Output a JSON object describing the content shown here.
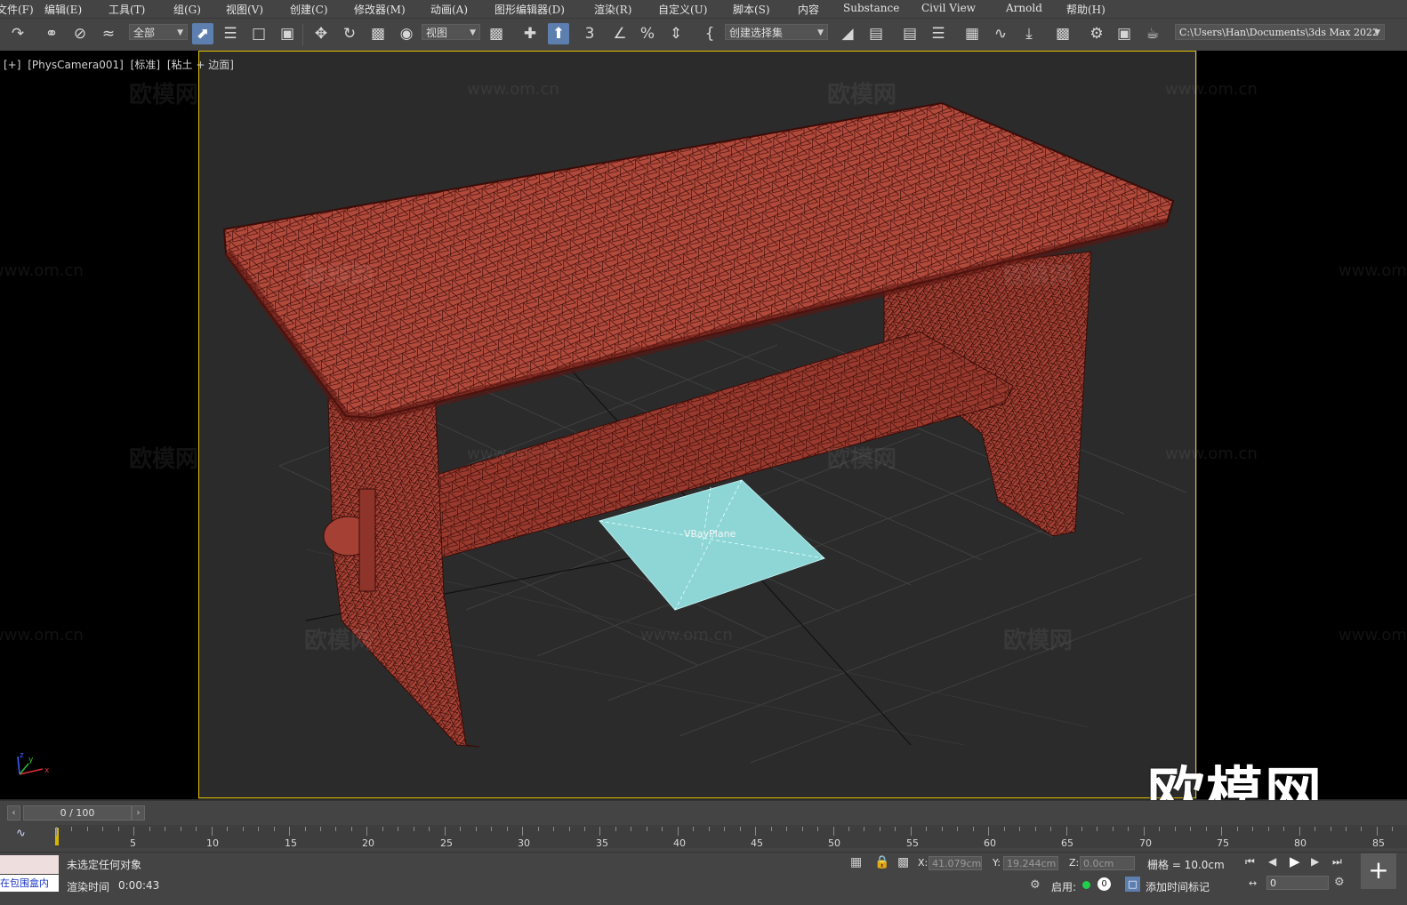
{
  "menu": {
    "items": [
      "文件(F)",
      "编辑(E)",
      "工具(T)",
      "组(G)",
      "视图(V)",
      "创建(C)",
      "修改器(M)",
      "动画(A)",
      "图形编辑器(D)",
      "渲染(R)",
      "自定义(U)",
      "脚本(S)",
      "内容",
      "Substance",
      "Civil View",
      "Arnold",
      "帮助(H)"
    ]
  },
  "toolbar": {
    "selection_filter": "全部",
    "reference_coord": "视图",
    "named_selection_set": "创建选择集",
    "project_path": "C:\\Users\\Han\\Documents\\3ds Max 2022"
  },
  "viewport": {
    "label_plus": "[+]",
    "label_camera": "[PhysCamera001]",
    "label_standard": "[标准]",
    "label_shading": "[粘土 + 边面]",
    "object_label": "VRayPlane",
    "watermark_cn": "欧模网",
    "watermark_url": "www.om.cn",
    "brand": "欧模网",
    "axis_x": "x",
    "axis_y": "y",
    "axis_z": "z"
  },
  "timeline": {
    "slider_text": "0 / 100",
    "ticks": [
      "5",
      "10",
      "15",
      "20",
      "25",
      "30",
      "35",
      "40",
      "45",
      "50",
      "55",
      "60",
      "65",
      "70",
      "75",
      "80",
      "85"
    ]
  },
  "status": {
    "maxscript_text": "在包围盒内",
    "selection_msg": "未选定任何对象",
    "render_time_label": "渲染时间",
    "render_time_value": "0:00:43",
    "x_label": "X:",
    "x_value": "41.079cm",
    "y_label": "Y:",
    "y_value": "19.244cm",
    "z_label": "Z:",
    "z_value": "0.0cm",
    "grid_text": "栅格 = 10.0cm",
    "enable_label": "启用:",
    "enable_count": "0",
    "add_time_tag": "添加时间标记",
    "frame_value": "0"
  },
  "colors": {
    "accent": "#5c7fb0",
    "viewport_border": "#e0c000",
    "mesh_fill": "#b24a3c",
    "mesh_wire": "#3a0c08",
    "plane_fill": "#8ed6d6"
  }
}
